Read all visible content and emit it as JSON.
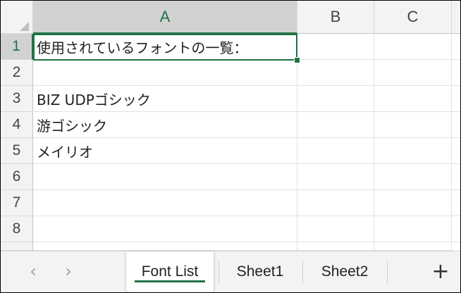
{
  "columns": [
    "A",
    "B",
    "C"
  ],
  "rows": [
    "1",
    "2",
    "3",
    "4",
    "5",
    "6",
    "7",
    "8"
  ],
  "cells": {
    "A1": "使用されているフォントの一覧：",
    "A3": "BIZ UDPゴシック",
    "A4": "游ゴシック",
    "A5": "メイリオ"
  },
  "active_cell": "A1",
  "nav": {
    "prev_label": "‹",
    "next_label": "›"
  },
  "tabs": [
    "Font List",
    "Sheet1",
    "Sheet2"
  ],
  "active_tab": "Font List",
  "add_sheet_label": "+",
  "colors": {
    "accent": "#217346",
    "header_bg": "#f3f3f3",
    "header_selected_bg": "#d2d2d2"
  }
}
